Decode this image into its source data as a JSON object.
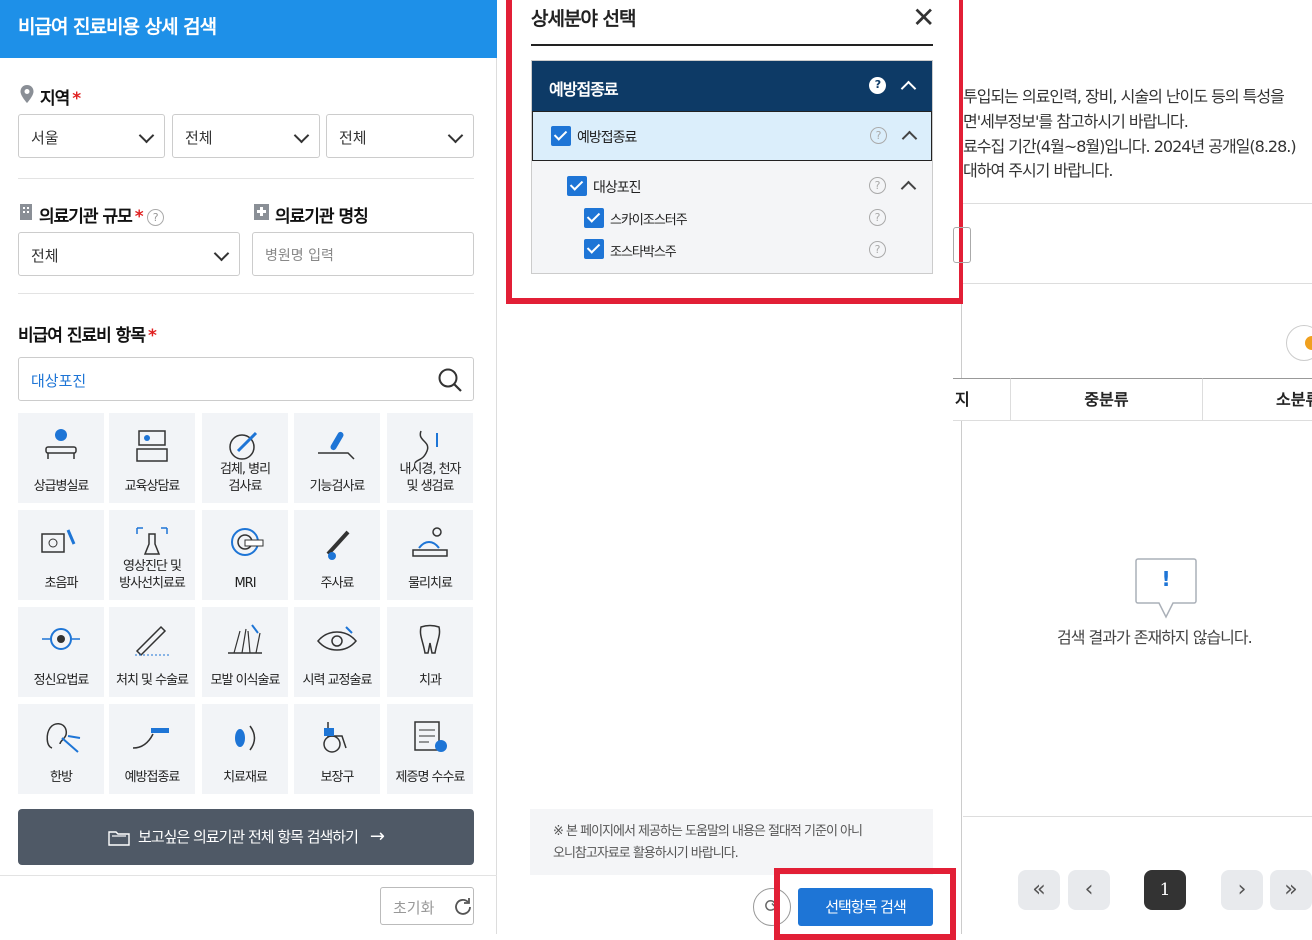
{
  "left": {
    "header_title": "비급여 진료비용 상세 검색",
    "region_label": "지역",
    "required_mark": "*",
    "region_selects": [
      "서울",
      "전체",
      "전체"
    ],
    "scale_label": "의료기관 규모",
    "scale_value": "전체",
    "help_mark": "?",
    "name_label": "의료기관 명칭",
    "name_placeholder": "병원명 입력",
    "items_label": "비급여 진료비 항목",
    "items_search_value": "대상포진",
    "categories": [
      {
        "label": "상급병실료",
        "icon": "hospital-bed-icon"
      },
      {
        "label": "교육상담료",
        "icon": "counseling-desk-icon"
      },
      {
        "label": "검체, 병리\n검사료",
        "icon": "lab-test-icon"
      },
      {
        "label": "기능검사료",
        "icon": "function-test-icon"
      },
      {
        "label": "내시경, 천자\n및 생검료",
        "icon": "endoscope-icon"
      },
      {
        "label": "초음파",
        "icon": "ultrasound-icon"
      },
      {
        "label": "영상진단 및\n방사선치료료",
        "icon": "xray-icon"
      },
      {
        "label": "MRI",
        "icon": "mri-icon"
      },
      {
        "label": "주사료",
        "icon": "syringe-icon"
      },
      {
        "label": "물리치료",
        "icon": "physical-therapy-icon"
      },
      {
        "label": "정신요법료",
        "icon": "brain-icon"
      },
      {
        "label": "처치 및 수술료",
        "icon": "scalpel-icon"
      },
      {
        "label": "모발 이식술료",
        "icon": "hair-transplant-icon"
      },
      {
        "label": "시력 교정술료",
        "icon": "eye-icon"
      },
      {
        "label": "치과",
        "icon": "tooth-icon"
      },
      {
        "label": "한방",
        "icon": "acupuncture-ear-icon"
      },
      {
        "label": "예방접종료",
        "icon": "vaccine-arm-icon"
      },
      {
        "label": "치료재료",
        "icon": "lens-material-icon"
      },
      {
        "label": "보장구",
        "icon": "wheelchair-icon"
      },
      {
        "label": "제증명 수수료",
        "icon": "certificate-icon"
      }
    ],
    "search_all_label": "보고싶은 의료기관 전체 항목 검색하기",
    "reset_label": "초기화"
  },
  "modal": {
    "title": "상세분야 선택",
    "close_symbol": "✕",
    "tree_header": "예방접종료",
    "level1": "예방접종료",
    "level2": "대상포진",
    "level3": [
      "스카이조스터주",
      "조스타박스주"
    ],
    "help_mark": "?",
    "note": [
      "※ 본 페이지에서 제공하는 도움말의 내용은 절대적 기준이 아니",
      "오니참고자료로 활용하시기 바랍니다."
    ],
    "select_search_label": "선택항목 검색"
  },
  "right": {
    "info_lines": [
      "투입되는 의료인력, 장비, 시술의 난이도 등의 특성을",
      "면'세부정보'를 참고하시기 바랍니다.",
      "료수집 기간(4월~8월)입니다. 2024년 공개일(8.28.)",
      "대하여 주시기 바랍니다."
    ],
    "col_partial": "지",
    "col_middle": "중분류",
    "col_small": "소분류",
    "empty_mark": "!",
    "empty_message": "검색 결과가 존재하지 않습니다.",
    "pagination": {
      "first": "«",
      "prev": "‹",
      "current": "1",
      "next": "›",
      "last": "»"
    }
  },
  "colors": {
    "header_blue": "#1e90e8",
    "tree_navy": "#0d3a66",
    "accent_blue": "#1e75d6",
    "highlight_red": "#e21f36",
    "dark_button": "#4f5966"
  }
}
